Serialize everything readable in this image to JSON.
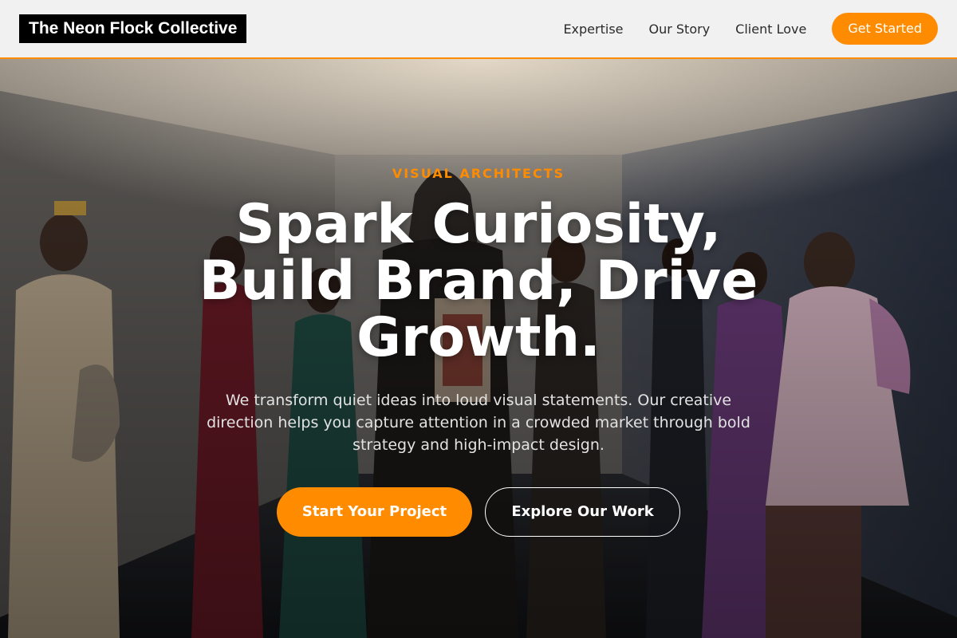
{
  "header": {
    "logo_text": "The Neon Flock Collective",
    "nav": {
      "items": [
        {
          "label": "Expertise"
        },
        {
          "label": "Our Story"
        },
        {
          "label": "Client Love"
        }
      ],
      "cta_label": "Get Started"
    }
  },
  "hero": {
    "eyebrow": "VISUAL ARCHITECTS",
    "headline": "Spark Curiosity, Build Brand, Drive Growth.",
    "subtext": "We transform quiet ideas into loud visual statements. Our creative direction helps you capture attention in a crowded market through bold strategy and high-impact design.",
    "primary_button": "Start Your Project",
    "secondary_button": "Explore Our Work",
    "background_image": "fashion-show-backdrop"
  },
  "colors": {
    "accent": "#ff8c00",
    "header_bg": "#f1f1f1",
    "logo_bg": "#000000",
    "text_light": "#ffffff"
  }
}
